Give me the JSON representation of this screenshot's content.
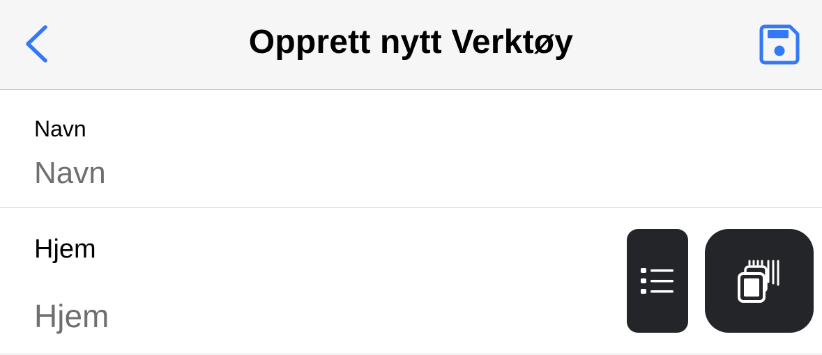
{
  "navbar": {
    "title": "Opprett nytt Verktøy",
    "back_icon": "chevron-left-icon",
    "save_icon": "floppy-disk-icon",
    "accent_color": "#3478f6"
  },
  "form": {
    "name": {
      "label": "Navn",
      "value": "",
      "placeholder": "Navn"
    },
    "home": {
      "label": "Hjem",
      "value": "",
      "placeholder": "Hjem"
    }
  },
  "floating_buttons": {
    "list_icon": "list-icon",
    "copy_icon": "stacked-cards-icon",
    "background_color": "#242528"
  }
}
